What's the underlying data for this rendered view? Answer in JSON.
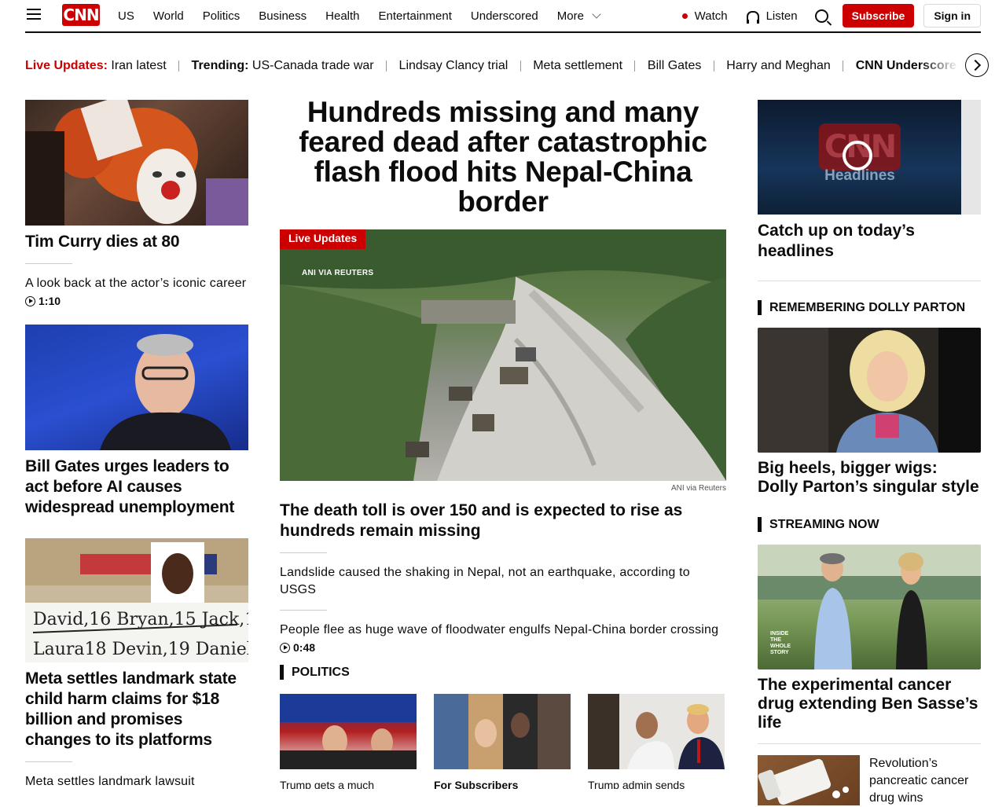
{
  "nav": {
    "logo": "CNN",
    "items": [
      "US",
      "World",
      "Politics",
      "Business",
      "Health",
      "Entertainment",
      "Underscored",
      "More"
    ],
    "watch": "Watch",
    "listen": "Listen",
    "subscribe": "Subscribe",
    "signin": "Sign in"
  },
  "trending": {
    "live_label": "Live Updates:",
    "live_item": "Iran latest",
    "trending_label": "Trending:",
    "items": [
      "US-Canada trade war",
      "Lindsay Clancy trial",
      "Meta settlement",
      "Bill Gates",
      "Harry and Meghan"
    ],
    "underscored": "CNN Underscored"
  },
  "left": {
    "card1": {
      "title": "Tim Curry dies at 80",
      "sub": "A look back at the actor’s iconic career",
      "duration": "1:10"
    },
    "card2": {
      "title": "Bill Gates urges leaders to act before AI causes widespread unemployment"
    },
    "card3": {
      "title": "Meta settles landmark state child harm claims for $18 billion and promises changes to its platforms",
      "sub": "Meta settles landmark lawsuit"
    }
  },
  "center": {
    "headline": "Hundreds missing and many feared dead after catastrophic flash flood hits Nepal-China border",
    "badge": "Live Updates",
    "watermark": "ANI VIA REUTERS",
    "credit": "ANI via Reuters",
    "subhead": "The death toll is over 150 and is expected to rise as hundreds remain missing",
    "link1": "Landslide caused the shaking in Nepal, not an earthquake, according to USGS",
    "link2": "People flee as huge wave of floodwater engulfs Nepal-China border crossing",
    "duration": "0:48",
    "politics_label": "POLITICS",
    "politics": [
      {
        "caption": "Trump gets a much"
      },
      {
        "caption": "For Subscribers"
      },
      {
        "caption": "Trump admin sends"
      }
    ]
  },
  "right": {
    "video_title": "Catch up on today’s headlines",
    "video_text": "Headlines",
    "dolly_label": "REMEMBERING DOLLY PARTON",
    "dolly_title": "Big heels, bigger wigs: Dolly Parton’s singular style",
    "streaming_label": "STREAMING NOW",
    "streaming_title": "The experimental cancer drug extending Ben Sasse’s life",
    "streaming_watermark": "INSIDE THE WHOLE STORY",
    "small_title": "Revolution’s pancreatic cancer drug wins"
  },
  "colors": {
    "brand_red": "#cc0000",
    "text": "#0c0c0c"
  }
}
